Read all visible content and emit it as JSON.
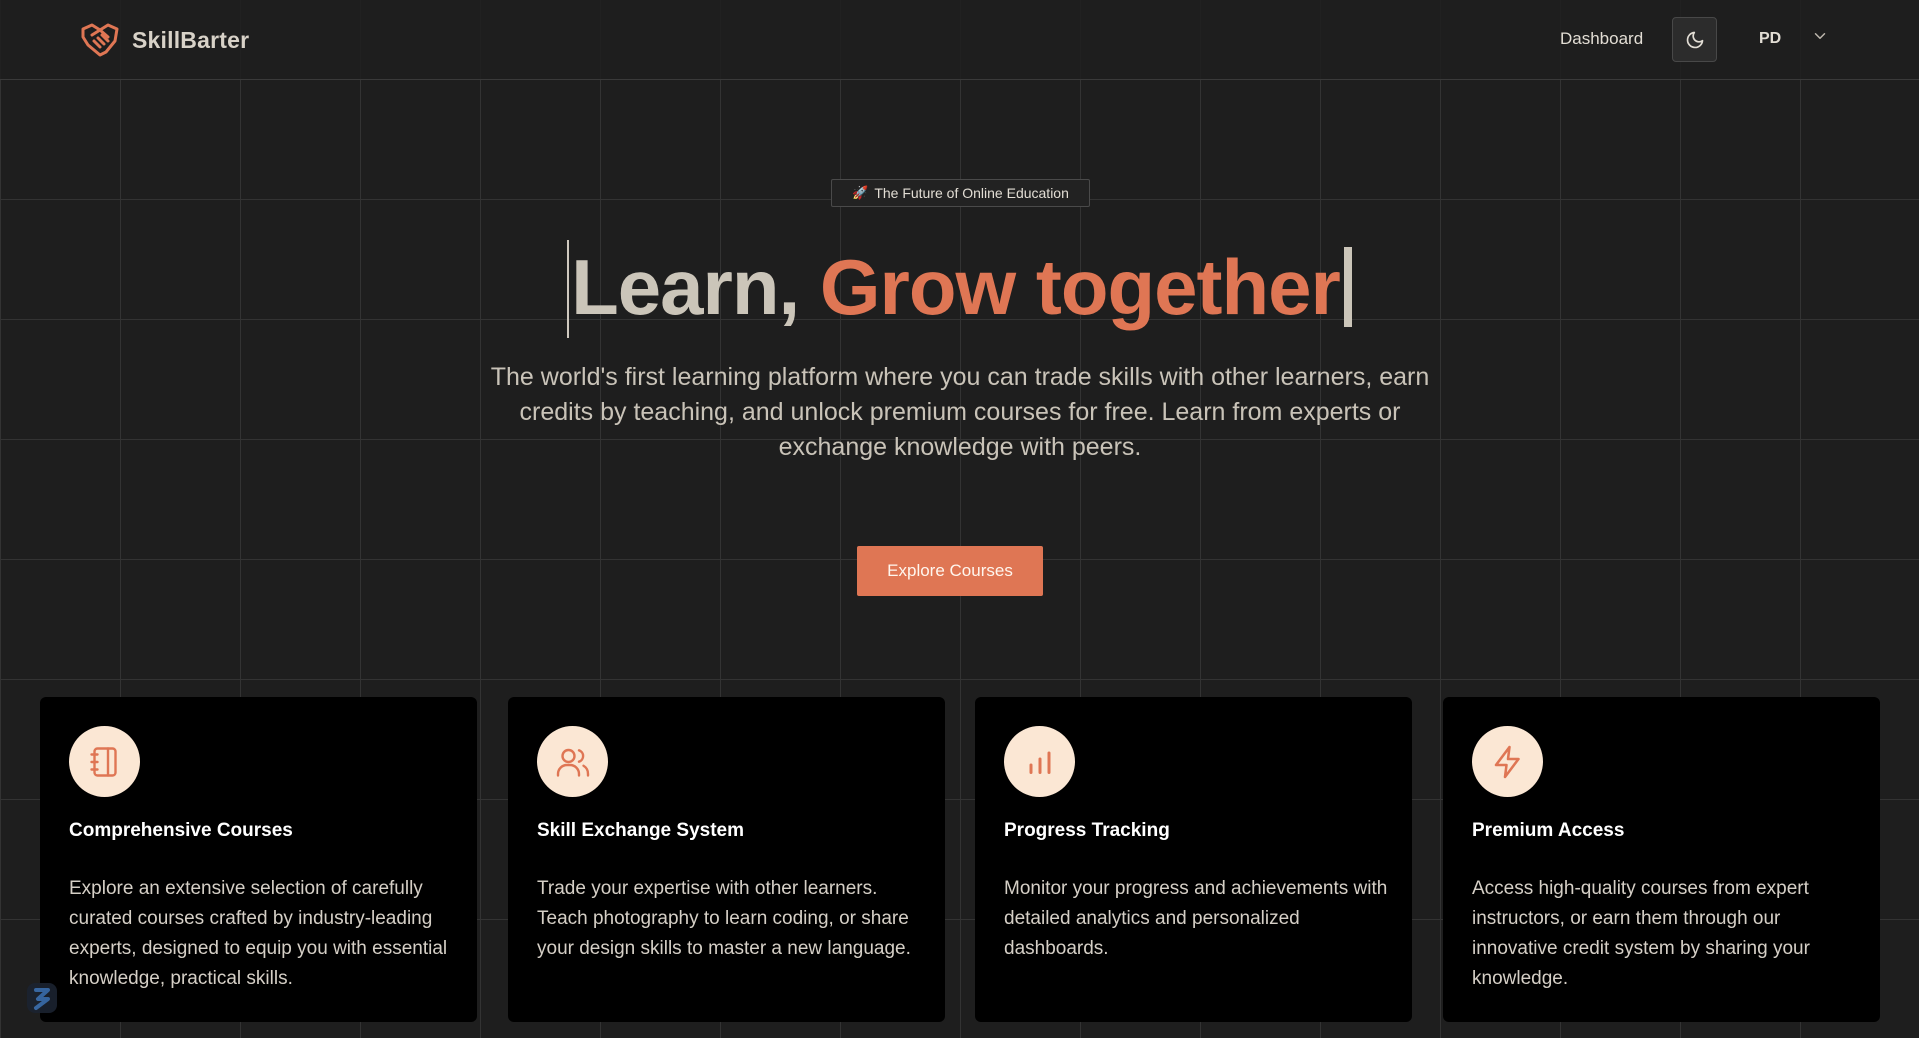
{
  "header": {
    "brand_name": "SkillBarter",
    "nav_dashboard": "Dashboard",
    "user_initials": "PD"
  },
  "hero": {
    "badge_icon": "🚀",
    "badge_text": "The Future of Online Education",
    "title_part1": "Learn, ",
    "title_part2": "Grow together",
    "subtitle": "The world's first learning platform where you can trade skills with other learners, earn credits by teaching, and unlock premium courses for free. Learn from experts or exchange knowledge with peers.",
    "cta_label": "Explore Courses"
  },
  "features": [
    {
      "icon": "notebook-icon",
      "title": "Comprehensive Courses",
      "description": "Explore an extensive selection of carefully curated courses crafted by industry-leading experts, designed to equip you with essential knowledge, practical skills."
    },
    {
      "icon": "users-icon",
      "title": "Skill Exchange System",
      "description": "Trade your expertise with other learners. Teach photography to learn coding, or share your design skills to master a new language."
    },
    {
      "icon": "bar-chart-icon",
      "title": "Progress Tracking",
      "description": "Monitor your progress and achievements with detailed analytics and personalized dashboards."
    },
    {
      "icon": "lightning-icon",
      "title": "Premium Access",
      "description": "Access high-quality courses from expert instructors, or earn them through our innovative credit system by sharing your knowledge."
    }
  ],
  "colors": {
    "accent": "#df7654",
    "background": "#1e1e1e",
    "card_background": "#000000",
    "icon_background": "#fbe7d4"
  }
}
